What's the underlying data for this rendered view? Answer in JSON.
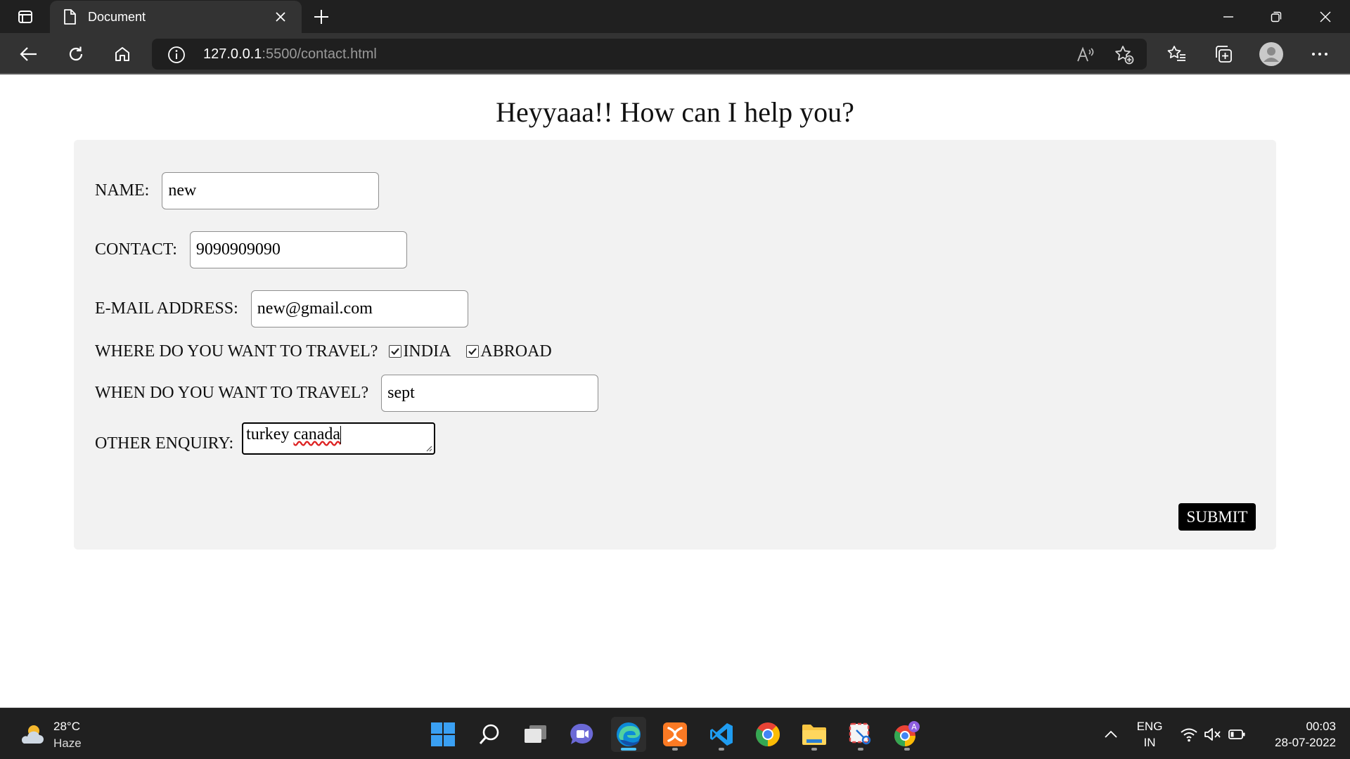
{
  "browser": {
    "tab_title": "Document",
    "url_host": "127.0.0.1",
    "url_rest": ":5500/contact.html"
  },
  "page": {
    "title": "Heyyaaa!! How can I help you?"
  },
  "form": {
    "name_label": "NAME:",
    "name_value": "new",
    "contact_label": "CONTACT:",
    "contact_value": "9090909090",
    "email_label": "E-MAIL ADDRESS:",
    "email_value": "new@gmail.com",
    "where_label": "WHERE DO YOU WANT TO TRAVEL?",
    "option_india": "INDIA",
    "option_india_checked": true,
    "option_abroad": "ABROAD",
    "option_abroad_checked": true,
    "when_label": "WHEN DO YOU WANT TO TRAVEL?",
    "when_value": "sept",
    "enquiry_label": "OTHER ENQUIRY:",
    "enquiry_value_plain": "turkey ",
    "enquiry_value_misspelled": "canada",
    "submit_label": "SUBMIT"
  },
  "taskbar": {
    "weather_temp": "28°C",
    "weather_desc": "Haze",
    "lang_line1": "ENG",
    "lang_line2": "IN",
    "time": "00:03",
    "date": "28-07-2022"
  },
  "colors": {
    "chrome_dark": "#202020",
    "toolbar": "#333333",
    "form_bg": "#f2f2f2",
    "edge_accent": "#4cc2ff",
    "submit_bg": "#000000"
  }
}
